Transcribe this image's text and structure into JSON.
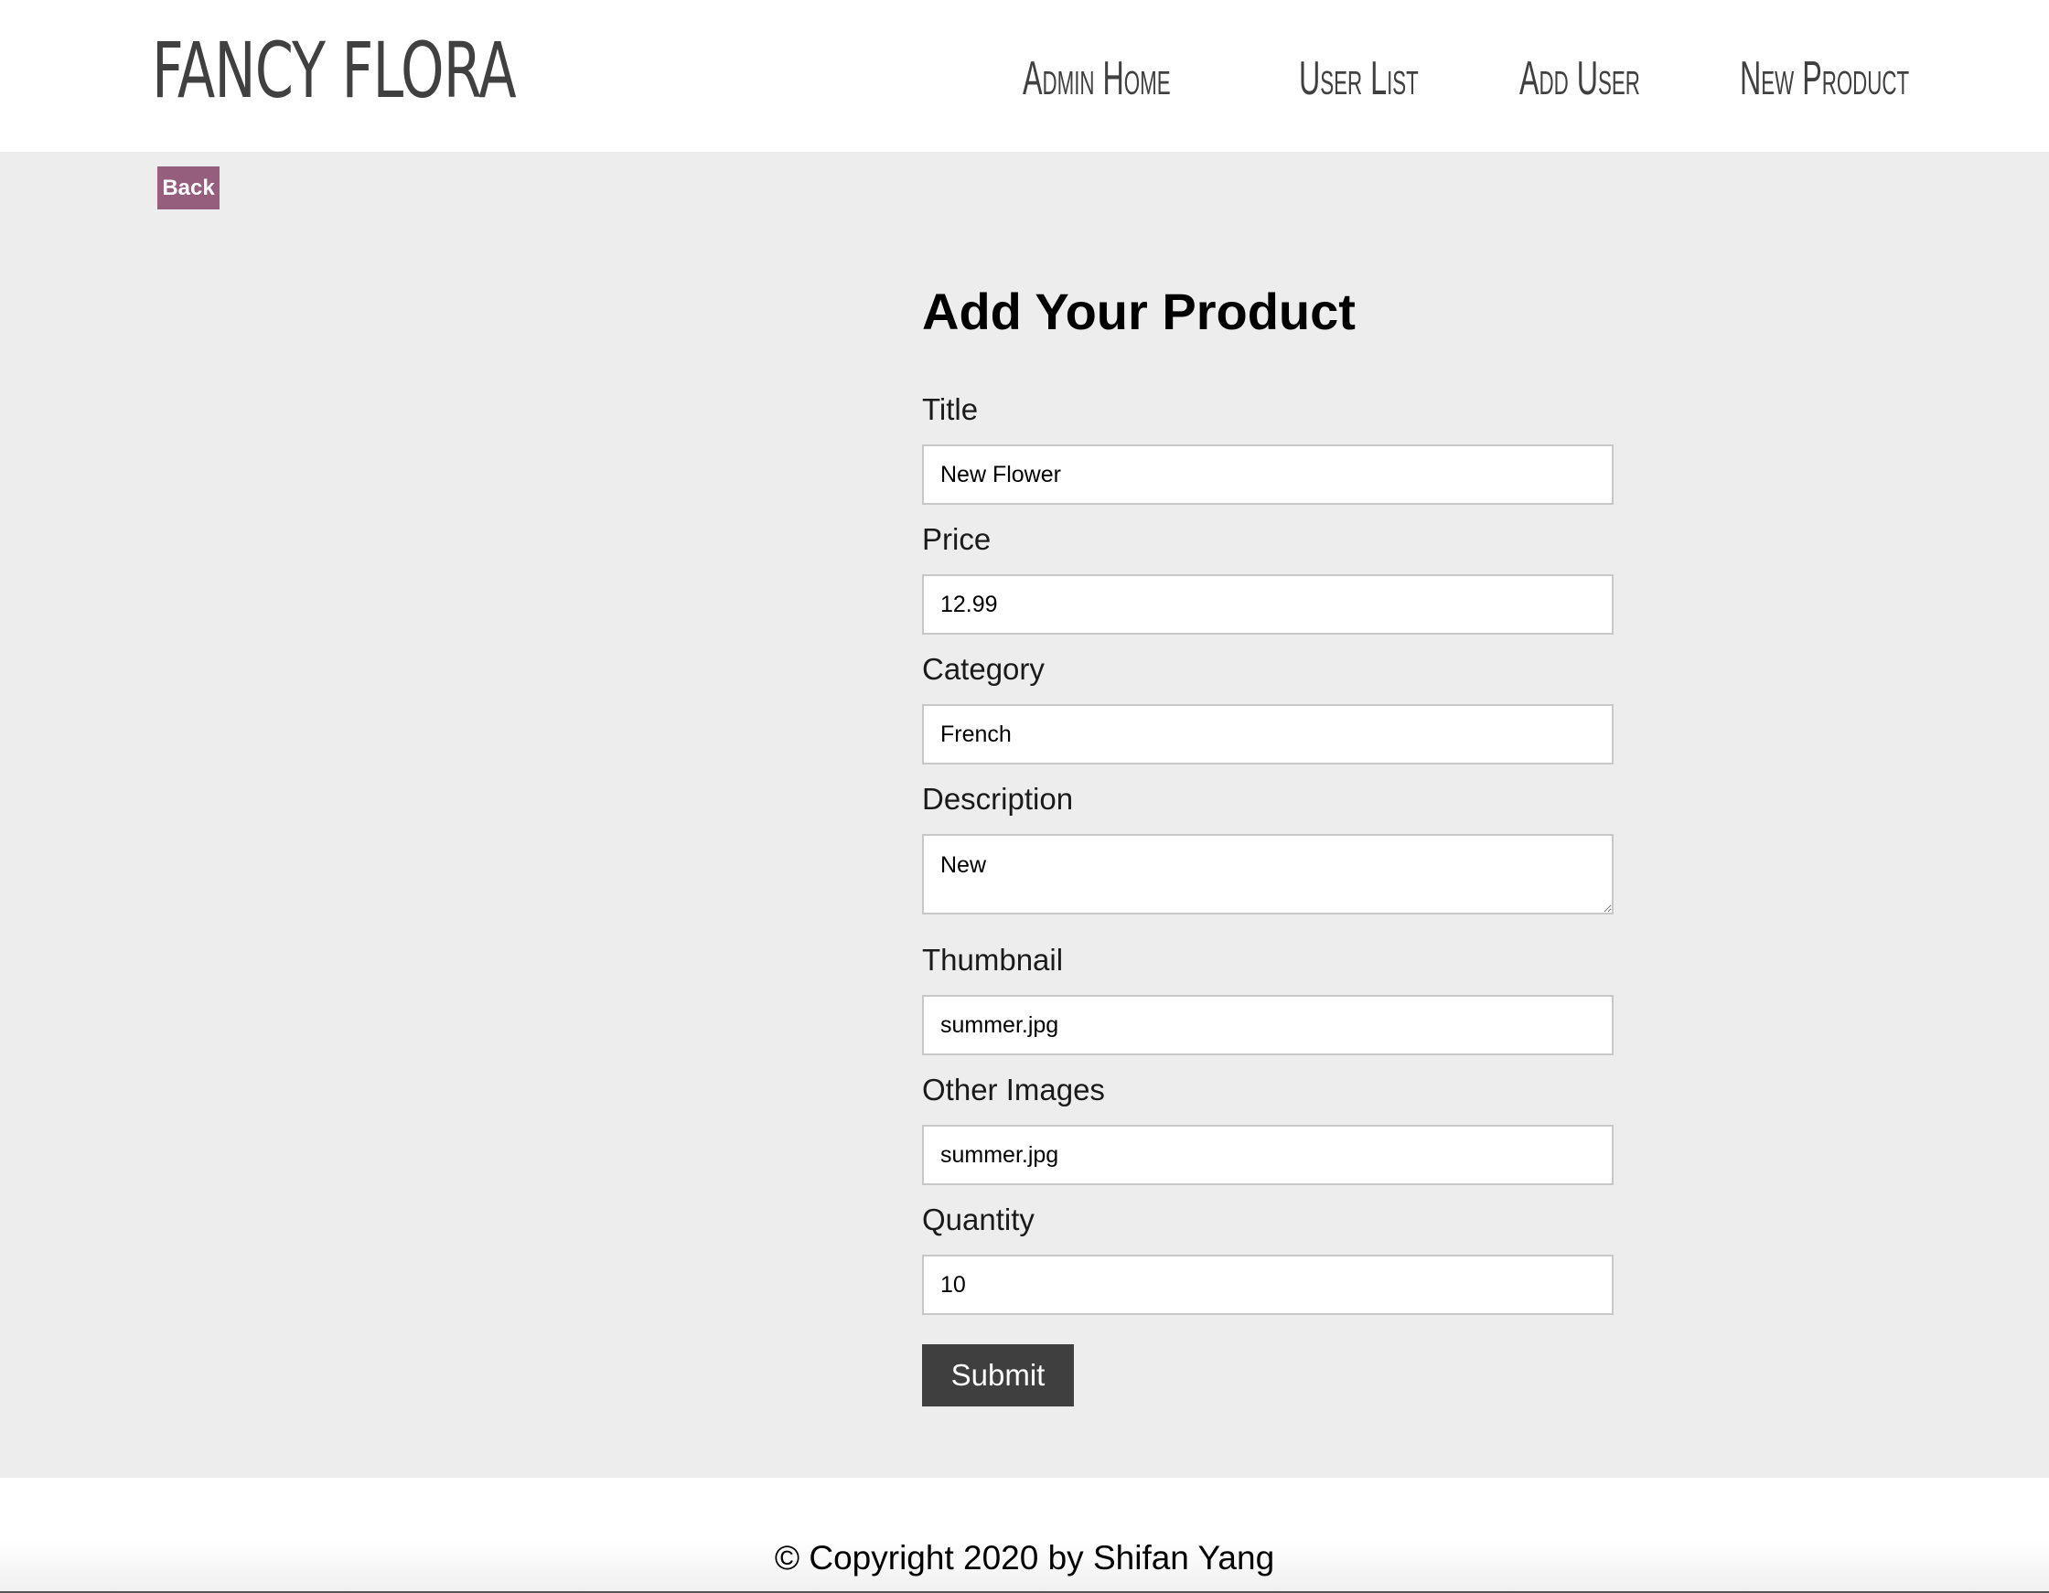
{
  "header": {
    "logo": "FANCY FLORA",
    "nav": [
      {
        "label": "Admin Home"
      },
      {
        "label": "User List"
      },
      {
        "label": "Add User"
      },
      {
        "label": "New Product"
      }
    ]
  },
  "back_label": "Back",
  "form": {
    "title": "Add Your Product",
    "fields": {
      "title": {
        "label": "Title",
        "value": "New Flower"
      },
      "price": {
        "label": "Price",
        "value": "12.99"
      },
      "category": {
        "label": "Category",
        "value": "French"
      },
      "description": {
        "label": "Description",
        "value": "New"
      },
      "thumbnail": {
        "label": "Thumbnail",
        "value": "summer.jpg"
      },
      "other_images": {
        "label": "Other Images",
        "value": "summer.jpg"
      },
      "quantity": {
        "label": "Quantity",
        "value": "10"
      }
    },
    "submit_label": "Submit"
  },
  "footer": {
    "copyright": "© Copyright 2020 by Shifan Yang"
  },
  "colors": {
    "page_background": "#ededed",
    "header_background": "#ffffff",
    "back_button": "#945e7c",
    "submit_button": "#3f3f3f",
    "nav_text": "#404040"
  }
}
